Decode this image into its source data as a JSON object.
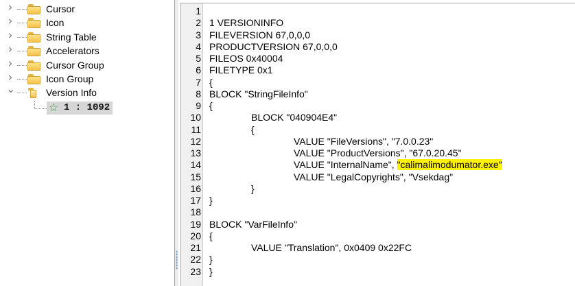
{
  "tree": {
    "items": [
      {
        "label": "Cursor",
        "expanded": false
      },
      {
        "label": "Icon",
        "expanded": false
      },
      {
        "label": "String Table",
        "expanded": false
      },
      {
        "label": "Accelerators",
        "expanded": false
      },
      {
        "label": "Cursor Group",
        "expanded": false
      },
      {
        "label": "Icon Group",
        "expanded": false
      },
      {
        "label": "Version Info",
        "expanded": true
      }
    ],
    "selected_child": {
      "label": "1 : 1092",
      "icon": "star-icon"
    }
  },
  "editor": {
    "line_numbers": [
      "1",
      "2",
      "3",
      "4",
      "5",
      "6",
      "7",
      "8",
      "9",
      "10",
      "11",
      "12",
      "13",
      "14",
      "15",
      "16",
      "17",
      "18",
      "19",
      "20",
      "21",
      "22",
      "23"
    ],
    "lines": [
      {
        "indent": 0,
        "text": ""
      },
      {
        "indent": 0,
        "text": "1 VERSIONINFO"
      },
      {
        "indent": 0,
        "text": "FILEVERSION 67,0,0,0"
      },
      {
        "indent": 0,
        "text": "PRODUCTVERSION 67,0,0,0"
      },
      {
        "indent": 0,
        "text": "FILEOS 0x40004"
      },
      {
        "indent": 0,
        "text": "FILETYPE 0x1"
      },
      {
        "indent": 0,
        "text": "{"
      },
      {
        "indent": 0,
        "text": "BLOCK \"StringFileInfo\""
      },
      {
        "indent": 0,
        "text": "{"
      },
      {
        "indent": 1,
        "text": "BLOCK \"040904E4\""
      },
      {
        "indent": 1,
        "text": "{"
      },
      {
        "indent": 2,
        "text": "VALUE \"FileVersions\", \"7.0.0.23\""
      },
      {
        "indent": 2,
        "text": "VALUE \"ProductVersions\", \"67.0.20.45\""
      },
      {
        "indent": 2,
        "text": "VALUE \"InternalName\", ",
        "highlight": "\"calimalimodumator.exe\""
      },
      {
        "indent": 2,
        "text": "VALUE \"LegalCopyrights\", \"Vsekdag\""
      },
      {
        "indent": 1,
        "text": "}"
      },
      {
        "indent": 0,
        "text": "}"
      },
      {
        "indent": 0,
        "text": ""
      },
      {
        "indent": 0,
        "text": "BLOCK \"VarFileInfo\""
      },
      {
        "indent": 0,
        "text": "{"
      },
      {
        "indent": 1,
        "text": "VALUE \"Translation\", 0x0409 0x22FC"
      },
      {
        "indent": 0,
        "text": "}"
      },
      {
        "indent": 0,
        "text": "}"
      }
    ],
    "highlight_color": "#fff200"
  }
}
